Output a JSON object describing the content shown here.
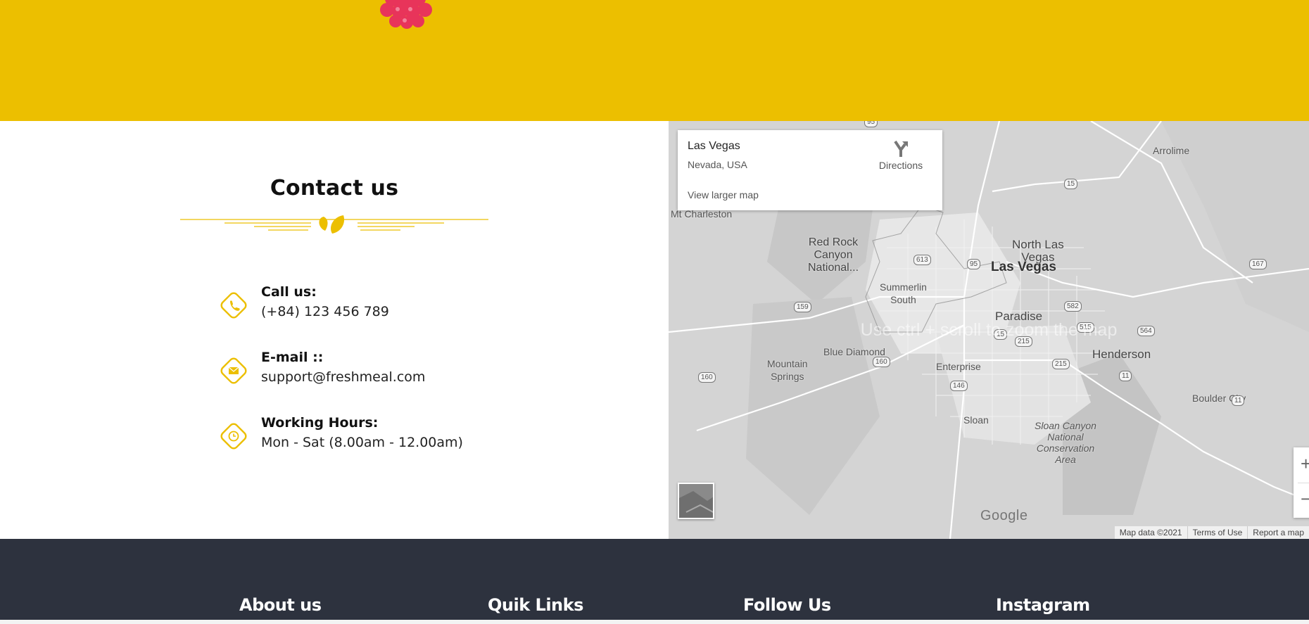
{
  "contact": {
    "title": "Contact us",
    "items": [
      {
        "icon": "phone-icon",
        "label": "Call us:",
        "value": "(+84) 123 456 789"
      },
      {
        "icon": "mail-icon",
        "label": "E-mail ::",
        "value": "support@freshmeal.com"
      },
      {
        "icon": "clock-icon",
        "label": "Working Hours:",
        "value": "Mon - Sat (8.00am - 12.00am)"
      }
    ]
  },
  "map": {
    "place_name": "Las Vegas",
    "place_address": "Nevada, USA",
    "directions_label": "Directions",
    "view_larger_label": "View larger map",
    "scroll_hint": "Use ctrl + scroll to zoom the map",
    "google_logo": "Google",
    "attribution": [
      "Map data ©2021",
      "Terms of Use",
      "Report a map"
    ],
    "labels": {
      "arrolime": "Arrolime",
      "mt_charleston": "Mt Charleston",
      "red_rock": "Red Rock\nCanyon\nNational...",
      "north_las_vegas": "North Las\nVegas",
      "las_vegas": "Las Vegas",
      "summerlin": "Summerlin\nSouth",
      "paradise": "Paradise",
      "blue_diamond": "Blue Diamond",
      "mountain_springs": "Mountain\nSprings",
      "enterprise": "Enterprise",
      "henderson": "Henderson",
      "boulder_city": "Boulder City",
      "sloan": "Sloan",
      "sloan_canyon": "Sloan Canyon\nNational\nConservation\nArea"
    },
    "shields": {
      "s95a": "95",
      "s15a": "15",
      "s613": "613",
      "s95b": "95",
      "s167": "167",
      "s159": "159",
      "s582": "582",
      "s515": "515",
      "s15b": "15",
      "s215a": "215",
      "s564": "564",
      "s160a": "160",
      "s160b": "160",
      "s215b": "215",
      "s11a": "11",
      "s146": "146",
      "s11b": "11"
    },
    "zoom_in": "+",
    "zoom_out": "−"
  },
  "footer": {
    "columns": [
      "About us",
      "Quik Links",
      "Follow Us",
      "Instagram"
    ]
  },
  "colors": {
    "accent": "#ecbf00",
    "footer_bg": "#2d323e"
  }
}
